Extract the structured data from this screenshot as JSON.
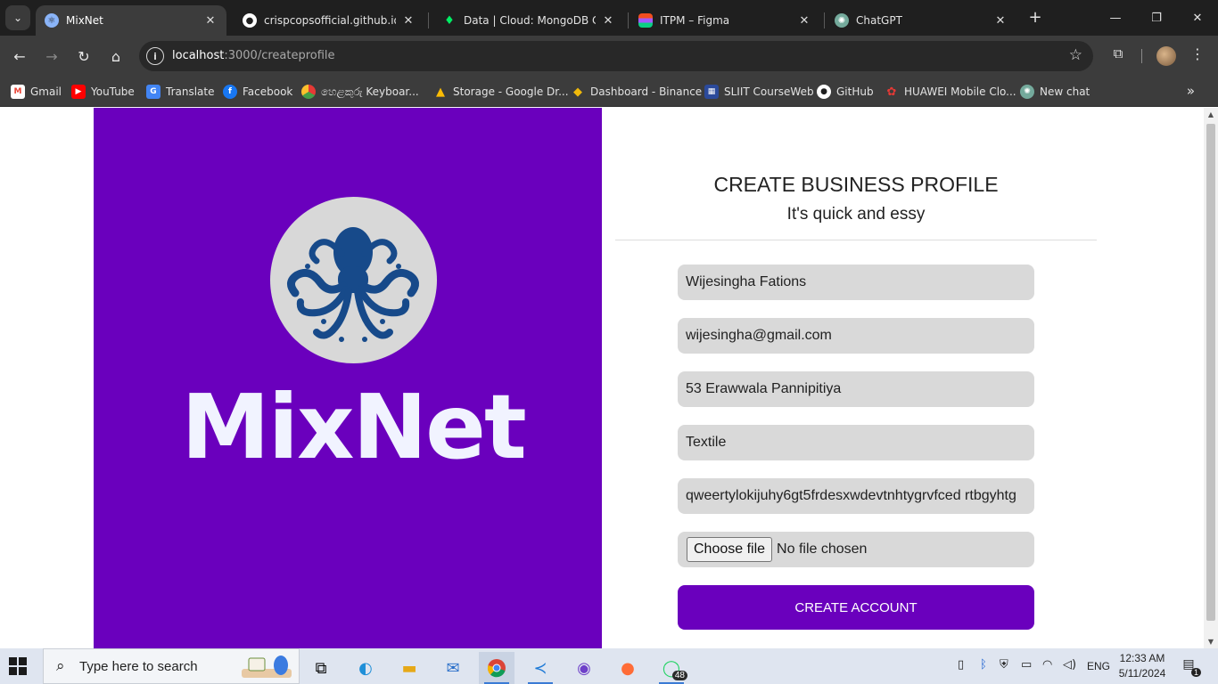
{
  "browser": {
    "tabs": [
      {
        "title": "MixNet",
        "active": true
      },
      {
        "title": "crispcopsofficial.github.io/fro",
        "active": false
      },
      {
        "title": "Data | Cloud: MongoDB Clou",
        "active": false
      },
      {
        "title": "ITPM – Figma",
        "active": false
      },
      {
        "title": "ChatGPT",
        "active": false
      }
    ],
    "address_bar": {
      "host": "localhost",
      "path": ":3000/createprofile"
    },
    "bookmarks": [
      {
        "label": "Gmail",
        "icon": "gmail-icon"
      },
      {
        "label": "YouTube",
        "icon": "youtube-icon"
      },
      {
        "label": "Translate",
        "icon": "translate-icon"
      },
      {
        "label": "Facebook",
        "icon": "facebook-icon"
      },
      {
        "label": "හෙළකුරු Keyboar...",
        "icon": "helakuru-icon"
      },
      {
        "label": "Storage - Google Dr...",
        "icon": "google-drive-icon"
      },
      {
        "label": "Dashboard - Binance",
        "icon": "binance-icon"
      },
      {
        "label": "SLIIT CourseWeb",
        "icon": "sliit-icon"
      },
      {
        "label": "GitHub",
        "icon": "github-icon"
      },
      {
        "label": "HUAWEI Mobile Clo...",
        "icon": "huawei-icon"
      },
      {
        "label": "New chat",
        "icon": "chatgpt-icon"
      }
    ]
  },
  "page": {
    "brand_name": "MixNet",
    "brand_color": "#6a00bd",
    "form": {
      "title": "CREATE BUSINESS PROFILE",
      "subtitle": "It's quick and essy",
      "fields": [
        {
          "name": "business-name",
          "value": "Wijesingha Fations"
        },
        {
          "name": "email",
          "value": "wijesingha@gmail.com"
        },
        {
          "name": "address",
          "value": "53 Erawwala Pannipitiya"
        },
        {
          "name": "category",
          "value": "Textile"
        },
        {
          "name": "description",
          "value": "qweertylokijuhy6gt5frdesxwdevtnhtygrvfced rtbgyhtg"
        }
      ],
      "file_button": "Choose file",
      "file_status": "No file chosen",
      "submit_label": "CREATE ACCOUNT"
    }
  },
  "taskbar": {
    "search_placeholder": "Type here to search",
    "whatsapp_badge": "48",
    "language": "ENG",
    "time": "12:33 AM",
    "date": "5/11/2024",
    "notification_count": "1"
  }
}
